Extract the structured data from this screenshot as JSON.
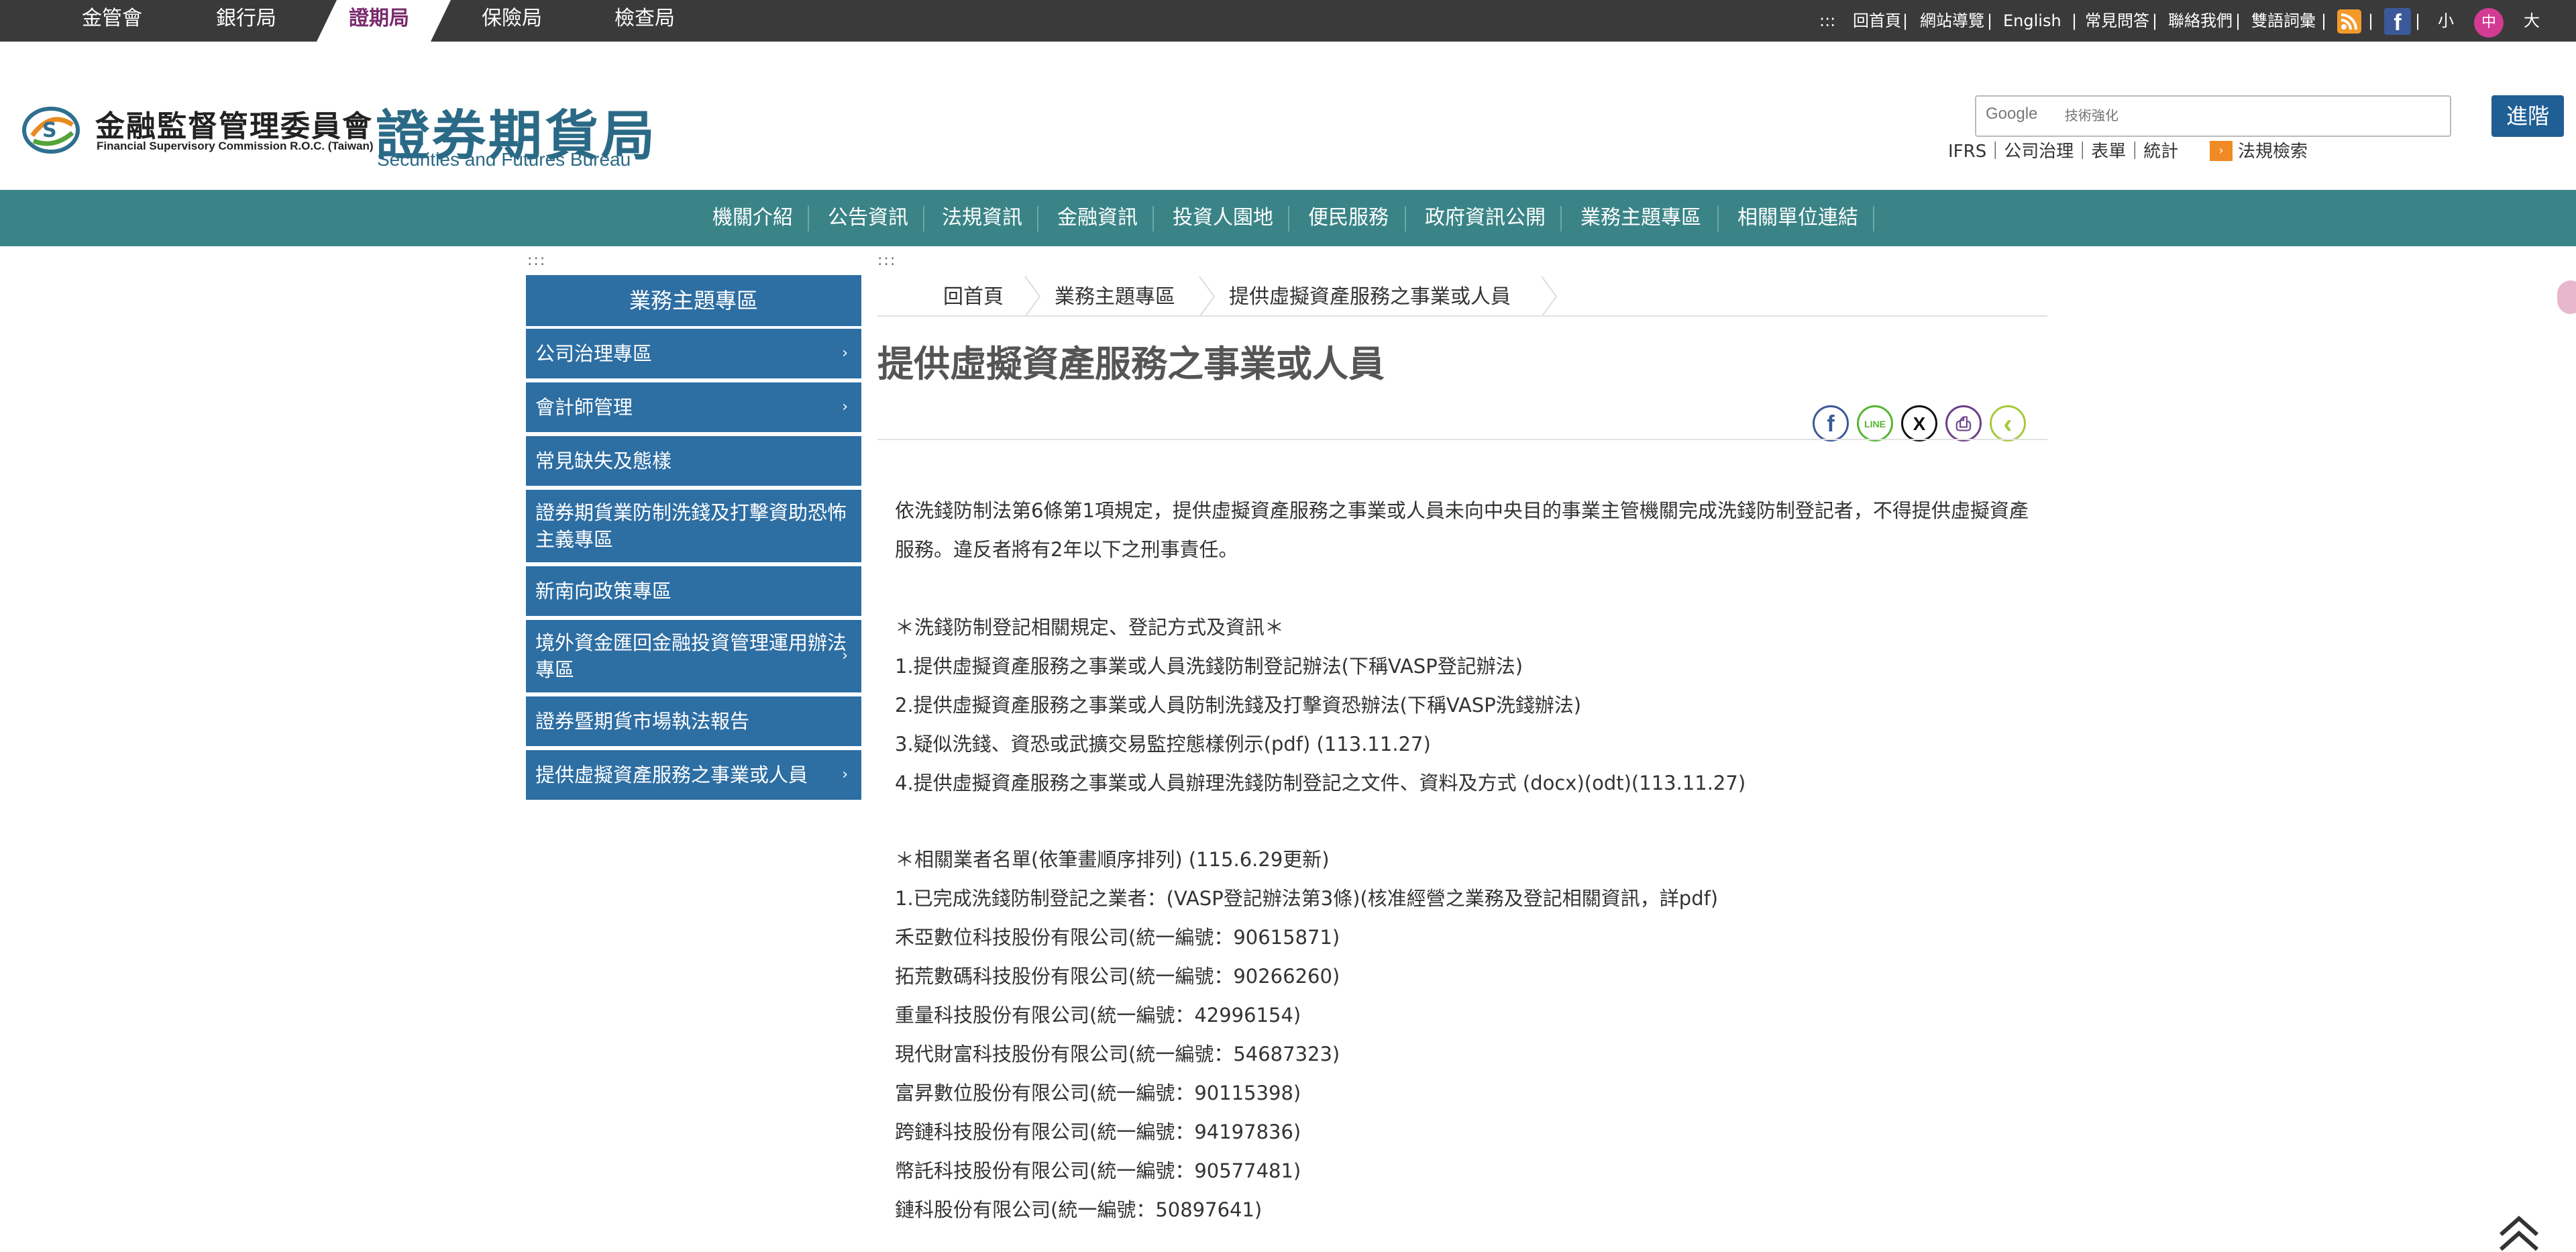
{
  "agency_tabs": [
    "金管會",
    "銀行局",
    "證期局",
    "保險局",
    "檢查局"
  ],
  "active_agency": "證期局",
  "top_links": {
    "accesskey": ":::",
    "items": [
      "回首頁",
      "網站導覽",
      "English",
      "常見問答",
      "聯絡我們",
      "雙語詞彙"
    ],
    "sep": "|",
    "font_small": "小",
    "font_medium": "中",
    "font_large": "大"
  },
  "header": {
    "fsc_name": "金融監督管理委員會",
    "fsc_en": "Financial Supervisory Commission R.O.C. (Taiwan)",
    "sfb_name": "證券期貨局",
    "sfb_en": "Securities and Futures Bureau",
    "search_brand": "Google",
    "search_placeholder": "技術強化",
    "advanced_label": "進階",
    "quick_links": "IFRS｜公司治理｜表單｜統計",
    "law_search": "法規檢索"
  },
  "main_nav": [
    "機關介紹",
    "公告資訊",
    "法規資訊",
    "金融資訊",
    "投資人園地",
    "便民服務",
    "政府資訊公開",
    "業務主題專區",
    "相關單位連結"
  ],
  "sidebar": {
    "accesskey": ":::",
    "title": "業務主題專區",
    "items": [
      {
        "label": "公司治理專區",
        "arrow": "›"
      },
      {
        "label": "會計師管理",
        "arrow": "›"
      },
      {
        "label": "常見缺失及態樣",
        "arrow": ""
      },
      {
        "label": "證券期貨業防制洗錢及打擊資助恐怖主義專區",
        "arrow": ""
      },
      {
        "label": "新南向政策專區",
        "arrow": ""
      },
      {
        "label": "境外資金匯回金融投資管理運用辦法專區",
        "arrow": "›"
      },
      {
        "label": "證券暨期貨市場執法報告",
        "arrow": ""
      },
      {
        "label": "提供虛擬資產服務之事業或人員",
        "arrow": "›"
      }
    ]
  },
  "content": {
    "accesskey": ":::",
    "breadcrumb": [
      "回首頁",
      "業務主題專區",
      "提供虛擬資產服務之事業或人員"
    ],
    "title": "提供虛擬資產服務之事業或人員",
    "share_icons": [
      "facebook-icon",
      "line-icon",
      "x-icon",
      "print-icon",
      "back-icon"
    ],
    "share_glyphs": {
      "facebook": "f",
      "line": "LINE",
      "x": "X",
      "print": "⎙",
      "back": "‹"
    },
    "intro_1": "依洗錢防制法第6條第1項規定，提供虛擬資產服務之事業或人員未向中央目的事業主管機關完成洗錢防制登記者，不得提供虛擬資產",
    "intro_2": "服務。違反者將有2年以下之刑事責任。",
    "section1_heading": "＊洗錢防制登記相關規定、登記方式及資訊＊",
    "section1_items": [
      "1.提供虛擬資產服務之事業或人員洗錢防制登記辦法(下稱VASP登記辦法)",
      "2.提供虛擬資產服務之事業或人員防制洗錢及打擊資恐辦法(下稱VASP洗錢辦法)",
      "3.疑似洗錢、資恐或武擴交易監控態樣例示(pdf) (113.11.27)",
      "4.提供虛擬資產服務之事業或人員辦理洗錢防制登記之文件、資料及方式 (docx)(odt)(113.11.27)"
    ],
    "section2_heading": "＊相關業者名單(依筆畫順序排列) (115.6.29更新)",
    "section2_intro": "1.已完成洗錢防制登記之業者：(VASP登記辦法第3條)(核准經營之業務及登記相關資訊，詳pdf)",
    "companies": [
      "禾亞數位科技股份有限公司(統一編號：90615871)",
      "拓荒數碼科技股份有限公司(統一編號：90266260)",
      "重量科技股份有限公司(統一編號：42996154)",
      "現代財富科技股份有限公司(統一編號：54687323)",
      "富昇數位股份有限公司(統一編號：90115398)",
      "跨鏈科技股份有限公司(統一編號：94197836)",
      "幣託科技股份有限公司(統一編號：90577481)",
      "鏈科股份有限公司(統一編號：50897641)"
    ]
  },
  "colors": {
    "topbar": "#3a3a3a",
    "nav": "#3a8487",
    "sidebar": "#2d6ea3",
    "brand_title": "#2b6a86",
    "active_agency_text": "#7a2a6e"
  }
}
